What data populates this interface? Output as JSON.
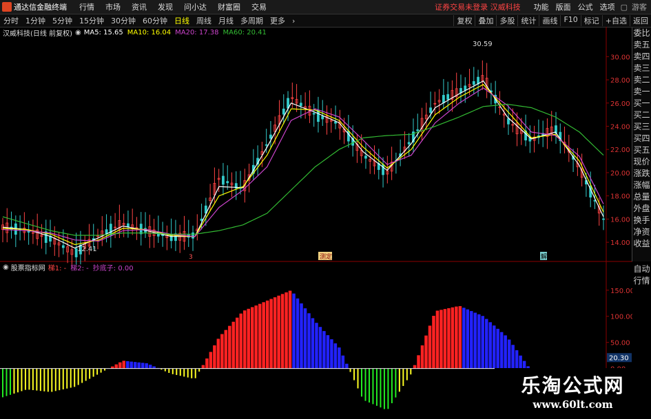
{
  "app": {
    "title": "通达信金融终端"
  },
  "menu": [
    "行情",
    "市场",
    "资讯",
    "发现",
    "问小达",
    "财富圈",
    "交易"
  ],
  "notice": "证券交易未登录  汉威科技",
  "right_menu": [
    "功能",
    "版面",
    "公式",
    "选项"
  ],
  "right_extra": "游客",
  "periods": [
    "分时",
    "1分钟",
    "5分钟",
    "15分钟",
    "30分钟",
    "60分钟",
    "日线",
    "周线",
    "月线",
    "多周期",
    "更多"
  ],
  "active_period": "日线",
  "tools": [
    "复权",
    "叠加",
    "多股",
    "统计",
    "画线",
    "F10",
    "标记",
    "+自选",
    "返回"
  ],
  "stock_info": {
    "name": "汉威科技(日线 前复权)",
    "ma5": "MA5: 15.65",
    "ma10": "MA10: 16.04",
    "ma20": "MA20: 17.38",
    "ma60": "MA60: 20.41"
  },
  "side_panel": [
    "委比",
    "卖五",
    "卖四",
    "卖三",
    "卖二",
    "卖一",
    "买一",
    "买二",
    "买三",
    "买四",
    "买五",
    "现价",
    "涨跌",
    "涨幅",
    "总量",
    "外盘",
    "换手",
    "净资",
    "收益"
  ],
  "side_lower": [
    "自动",
    "行情"
  ],
  "indicator_header": {
    "name": "股票指标网",
    "l1": "梯1: -",
    "l2": "梯2: -",
    "l3": "抄底子: 0.00"
  },
  "price_annotations": {
    "high": "30.59",
    "low": "12.41"
  },
  "markers": [
    "3",
    "测定",
    "解"
  ],
  "watermark": {
    "main": "乐淘公式网",
    "url": "www.60lt.com"
  },
  "chart_data": [
    {
      "type": "candlestick",
      "title": "汉威科技(日线 前复权)",
      "y_ticks": [
        "30.00",
        "28.00",
        "26.00",
        "24.00",
        "22.00",
        "20.00",
        "18.00",
        "16.00",
        "14.00"
      ],
      "ylim": [
        13.0,
        31.5
      ],
      "high": 30.59,
      "low": 12.41,
      "x": [
        0,
        4,
        8,
        12,
        16,
        20,
        24,
        28,
        32,
        36,
        40,
        44,
        48,
        52,
        56,
        60,
        64,
        68,
        72,
        76,
        80,
        84,
        88,
        92,
        96,
        100
      ],
      "close": [
        15.3,
        15.0,
        14.3,
        13.0,
        14.6,
        15.6,
        15.0,
        14.4,
        14.6,
        19.5,
        18.6,
        22.5,
        26.5,
        25.0,
        24.2,
        21.5,
        20.0,
        22.8,
        26.0,
        27.0,
        28.2,
        24.5,
        22.8,
        23.8,
        20.4,
        16.0
      ],
      "series": [
        {
          "name": "MA5",
          "color": "#ffffff",
          "values": [
            15.3,
            15.1,
            14.5,
            13.5,
            14.4,
            15.4,
            15.0,
            14.5,
            14.5,
            18.8,
            18.7,
            22.2,
            26.0,
            25.2,
            24.3,
            21.8,
            20.2,
            22.5,
            25.6,
            26.8,
            27.9,
            24.8,
            22.9,
            23.5,
            20.6,
            16.2
          ]
        },
        {
          "name": "MA10",
          "color": "#ffff00",
          "values": [
            15.2,
            15.1,
            14.7,
            13.8,
            14.2,
            15.2,
            15.1,
            14.6,
            14.5,
            18.0,
            18.8,
            21.5,
            25.5,
            25.4,
            24.5,
            22.2,
            20.4,
            22.0,
            25.0,
            26.5,
            27.6,
            25.3,
            23.0,
            23.3,
            21.0,
            16.6
          ]
        },
        {
          "name": "MA20",
          "color": "#cc44cc",
          "values": [
            15.1,
            15.0,
            14.8,
            14.2,
            14.1,
            15.0,
            15.1,
            14.7,
            14.5,
            17.0,
            18.5,
            20.5,
            24.5,
            25.5,
            24.8,
            22.8,
            20.7,
            21.5,
            24.3,
            26.0,
            27.3,
            25.8,
            23.5,
            23.2,
            21.4,
            17.3
          ]
        },
        {
          "name": "MA60",
          "color": "#33bb33",
          "values": [
            16.2,
            15.6,
            15.0,
            14.6,
            14.6,
            14.8,
            14.8,
            14.7,
            14.7,
            15.0,
            15.5,
            16.5,
            18.5,
            20.5,
            22.0,
            23.0,
            23.2,
            23.3,
            24.0,
            24.8,
            25.7,
            25.9,
            25.6,
            24.8,
            23.5,
            21.5
          ]
        }
      ]
    },
    {
      "type": "area",
      "title": "股票指标网",
      "y_ticks": [
        "150.00",
        "100.00",
        "50.00",
        "0.00"
      ],
      "current_value": "20.30",
      "ylim": [
        -90,
        180
      ],
      "x": [
        0,
        4,
        8,
        12,
        16,
        20,
        24,
        28,
        32,
        36,
        40,
        44,
        48,
        52,
        56,
        60,
        64,
        68,
        72,
        76,
        80,
        84,
        88,
        92,
        96,
        100
      ],
      "values": [
        -55,
        -40,
        -45,
        -35,
        -10,
        15,
        10,
        -10,
        -20,
        60,
        110,
        130,
        150,
        90,
        40,
        -60,
        -80,
        -10,
        110,
        120,
        100,
        60,
        -5,
        -10,
        -5,
        0
      ]
    }
  ]
}
